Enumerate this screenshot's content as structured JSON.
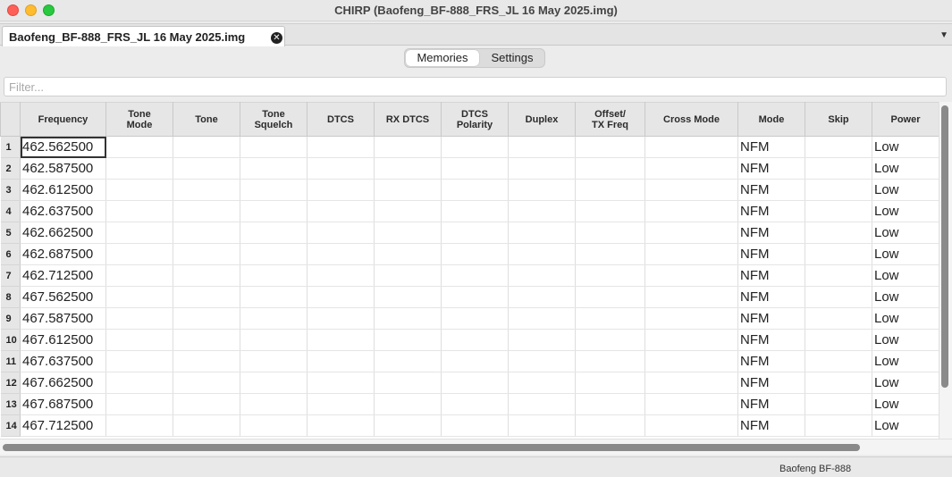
{
  "window": {
    "title": "CHIRP (Baofeng_BF-888_FRS_JL 16 May 2025.img)"
  },
  "file_tab": {
    "label": "Baofeng_BF-888_FRS_JL 16 May 2025.img",
    "close_glyph": "✕"
  },
  "tab_menu_glyph": "▼",
  "view_tabs": [
    {
      "label": "Memories",
      "active": true
    },
    {
      "label": "Settings",
      "active": false
    }
  ],
  "filter": {
    "placeholder": "Filter..."
  },
  "table": {
    "columns": [
      {
        "key": "frequency",
        "label": "Frequency"
      },
      {
        "key": "tone_mode",
        "label": "Tone\nMode"
      },
      {
        "key": "tone",
        "label": "Tone"
      },
      {
        "key": "tone_squelch",
        "label": "Tone\nSquelch"
      },
      {
        "key": "dtcs",
        "label": "DTCS"
      },
      {
        "key": "rx_dtcs",
        "label": "RX DTCS"
      },
      {
        "key": "dtcs_polarity",
        "label": "DTCS\nPolarity"
      },
      {
        "key": "duplex",
        "label": "Duplex"
      },
      {
        "key": "offset",
        "label": "Offset/\nTX Freq"
      },
      {
        "key": "cross_mode",
        "label": "Cross Mode"
      },
      {
        "key": "mode",
        "label": "Mode"
      },
      {
        "key": "skip",
        "label": "Skip"
      },
      {
        "key": "power",
        "label": "Power"
      }
    ],
    "rows": [
      {
        "num": "1",
        "frequency": "462.562500",
        "tone_mode": "",
        "tone": "",
        "tone_squelch": "",
        "dtcs": "",
        "rx_dtcs": "",
        "dtcs_polarity": "",
        "duplex": "",
        "offset": "",
        "cross_mode": "",
        "mode": "NFM",
        "skip": "",
        "power": "Low"
      },
      {
        "num": "2",
        "frequency": "462.587500",
        "tone_mode": "",
        "tone": "",
        "tone_squelch": "",
        "dtcs": "",
        "rx_dtcs": "",
        "dtcs_polarity": "",
        "duplex": "",
        "offset": "",
        "cross_mode": "",
        "mode": "NFM",
        "skip": "",
        "power": "Low"
      },
      {
        "num": "3",
        "frequency": "462.612500",
        "tone_mode": "",
        "tone": "",
        "tone_squelch": "",
        "dtcs": "",
        "rx_dtcs": "",
        "dtcs_polarity": "",
        "duplex": "",
        "offset": "",
        "cross_mode": "",
        "mode": "NFM",
        "skip": "",
        "power": "Low"
      },
      {
        "num": "4",
        "frequency": "462.637500",
        "tone_mode": "",
        "tone": "",
        "tone_squelch": "",
        "dtcs": "",
        "rx_dtcs": "",
        "dtcs_polarity": "",
        "duplex": "",
        "offset": "",
        "cross_mode": "",
        "mode": "NFM",
        "skip": "",
        "power": "Low"
      },
      {
        "num": "5",
        "frequency": "462.662500",
        "tone_mode": "",
        "tone": "",
        "tone_squelch": "",
        "dtcs": "",
        "rx_dtcs": "",
        "dtcs_polarity": "",
        "duplex": "",
        "offset": "",
        "cross_mode": "",
        "mode": "NFM",
        "skip": "",
        "power": "Low"
      },
      {
        "num": "6",
        "frequency": "462.687500",
        "tone_mode": "",
        "tone": "",
        "tone_squelch": "",
        "dtcs": "",
        "rx_dtcs": "",
        "dtcs_polarity": "",
        "duplex": "",
        "offset": "",
        "cross_mode": "",
        "mode": "NFM",
        "skip": "",
        "power": "Low"
      },
      {
        "num": "7",
        "frequency": "462.712500",
        "tone_mode": "",
        "tone": "",
        "tone_squelch": "",
        "dtcs": "",
        "rx_dtcs": "",
        "dtcs_polarity": "",
        "duplex": "",
        "offset": "",
        "cross_mode": "",
        "mode": "NFM",
        "skip": "",
        "power": "Low"
      },
      {
        "num": "8",
        "frequency": "467.562500",
        "tone_mode": "",
        "tone": "",
        "tone_squelch": "",
        "dtcs": "",
        "rx_dtcs": "",
        "dtcs_polarity": "",
        "duplex": "",
        "offset": "",
        "cross_mode": "",
        "mode": "NFM",
        "skip": "",
        "power": "Low"
      },
      {
        "num": "9",
        "frequency": "467.587500",
        "tone_mode": "",
        "tone": "",
        "tone_squelch": "",
        "dtcs": "",
        "rx_dtcs": "",
        "dtcs_polarity": "",
        "duplex": "",
        "offset": "",
        "cross_mode": "",
        "mode": "NFM",
        "skip": "",
        "power": "Low"
      },
      {
        "num": "10",
        "frequency": "467.612500",
        "tone_mode": "",
        "tone": "",
        "tone_squelch": "",
        "dtcs": "",
        "rx_dtcs": "",
        "dtcs_polarity": "",
        "duplex": "",
        "offset": "",
        "cross_mode": "",
        "mode": "NFM",
        "skip": "",
        "power": "Low"
      },
      {
        "num": "11",
        "frequency": "467.637500",
        "tone_mode": "",
        "tone": "",
        "tone_squelch": "",
        "dtcs": "",
        "rx_dtcs": "",
        "dtcs_polarity": "",
        "duplex": "",
        "offset": "",
        "cross_mode": "",
        "mode": "NFM",
        "skip": "",
        "power": "Low"
      },
      {
        "num": "12",
        "frequency": "467.662500",
        "tone_mode": "",
        "tone": "",
        "tone_squelch": "",
        "dtcs": "",
        "rx_dtcs": "",
        "dtcs_polarity": "",
        "duplex": "",
        "offset": "",
        "cross_mode": "",
        "mode": "NFM",
        "skip": "",
        "power": "Low"
      },
      {
        "num": "13",
        "frequency": "467.687500",
        "tone_mode": "",
        "tone": "",
        "tone_squelch": "",
        "dtcs": "",
        "rx_dtcs": "",
        "dtcs_polarity": "",
        "duplex": "",
        "offset": "",
        "cross_mode": "",
        "mode": "NFM",
        "skip": "",
        "power": "Low"
      },
      {
        "num": "14",
        "frequency": "467.712500",
        "tone_mode": "",
        "tone": "",
        "tone_squelch": "",
        "dtcs": "",
        "rx_dtcs": "",
        "dtcs_polarity": "",
        "duplex": "",
        "offset": "",
        "cross_mode": "",
        "mode": "NFM",
        "skip": "",
        "power": "Low"
      }
    ]
  },
  "status": {
    "radio_model": "Baofeng BF-888"
  }
}
